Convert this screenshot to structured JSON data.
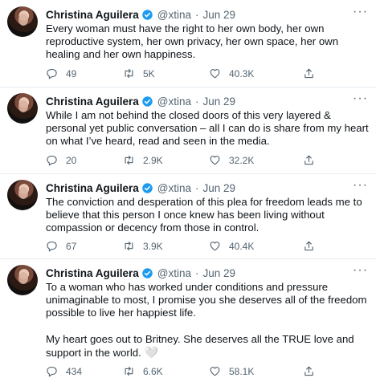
{
  "tweets": [
    {
      "name": "Christina Aguilera",
      "handle": "@xtina",
      "sep": "·",
      "date": "Jun 29",
      "more": "···",
      "paragraphs": [
        "Every woman must have the right to her own body, her own reproductive system, her own privacy, her own space, her own healing and her own happiness."
      ],
      "replies": "49",
      "retweets": "5K",
      "likes": "40.3K"
    },
    {
      "name": "Christina Aguilera",
      "handle": "@xtina",
      "sep": "·",
      "date": "Jun 29",
      "more": "···",
      "paragraphs": [
        "While I am not behind the closed doors of this very layered & personal yet public conversation – all I can do is share from my heart on what I’ve heard, read and seen in the media."
      ],
      "replies": "20",
      "retweets": "2.9K",
      "likes": "32.2K"
    },
    {
      "name": "Christina Aguilera",
      "handle": "@xtina",
      "sep": "·",
      "date": "Jun 29",
      "more": "···",
      "paragraphs": [
        "The conviction and desperation of this plea for freedom leads me to believe that this person I once knew has been living without compassion or decency from those in control."
      ],
      "replies": "67",
      "retweets": "3.9K",
      "likes": "40.4K"
    },
    {
      "name": "Christina Aguilera",
      "handle": "@xtina",
      "sep": "·",
      "date": "Jun 29",
      "more": "···",
      "paragraphs": [
        "To a woman who has worked under conditions and pressure unimaginable to most, I promise you she deserves all of the freedom possible to live her happiest life.",
        "My heart goes out to Britney. She deserves all the TRUE love and support in the world."
      ],
      "emoji": "🤍",
      "replies": "434",
      "retweets": "6.6K",
      "likes": "58.1K"
    }
  ],
  "icons": {
    "reply": "reply-icon",
    "retweet": "retweet-icon",
    "like": "like-icon",
    "share": "share-icon",
    "verified": "verified-badge-icon",
    "more": "more-options-icon"
  },
  "colors": {
    "verified": "#1d9bf0",
    "text": "#0f1419",
    "muted": "#536471",
    "divider": "#e6ecf0"
  }
}
